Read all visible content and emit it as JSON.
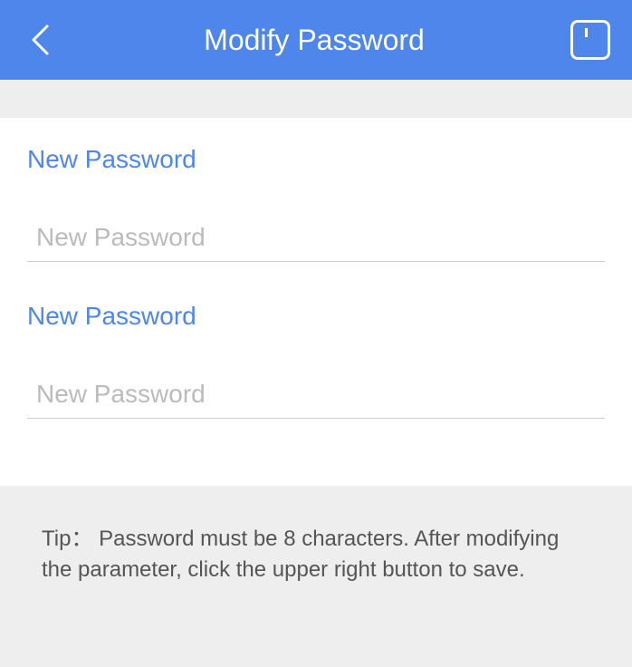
{
  "header": {
    "title": "Modify Password"
  },
  "fields": [
    {
      "label": "New Password",
      "placeholder": "New Password",
      "value": ""
    },
    {
      "label": "New Password",
      "placeholder": "New Password",
      "value": ""
    }
  ],
  "tip": "Tip： Password must be 8 characters. After modifying the parameter, click the upper right button to save."
}
